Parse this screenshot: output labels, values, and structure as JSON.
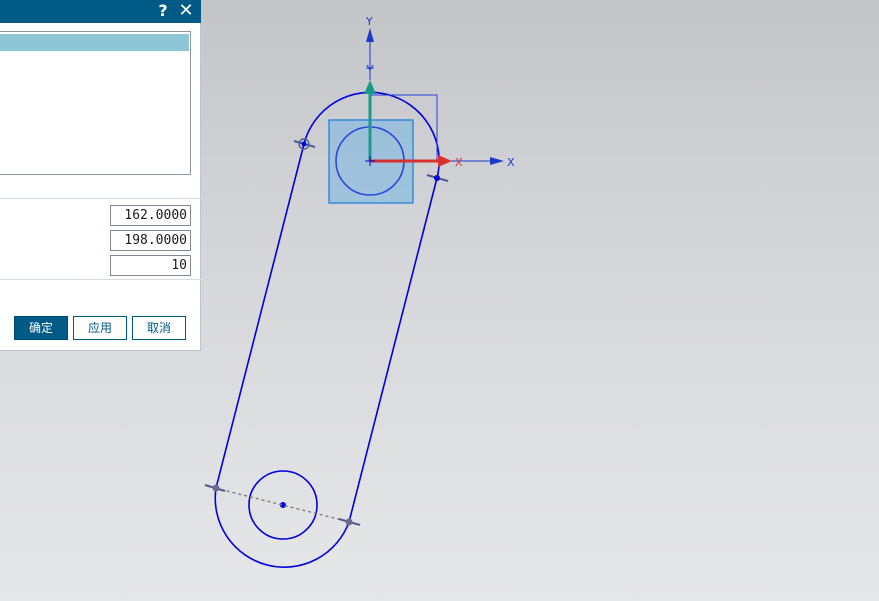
{
  "dialog": {
    "help_label": "?",
    "close_label": "✕",
    "fields": [
      "162.0000",
      "198.0000",
      "10"
    ],
    "ok_label": "确定",
    "apply_label": "应用",
    "cancel_label": "取消"
  },
  "viewport": {
    "axis_y_label": "Y",
    "axis_x_label": "X",
    "handle_x_label": "X",
    "colors": {
      "geometry": "#0000dd",
      "dynamic_handle_x": "#d93030",
      "dynamic_handle_y": "#1a9a8c",
      "handle_box": "#5aaee6",
      "hint_line": "#777777"
    }
  }
}
